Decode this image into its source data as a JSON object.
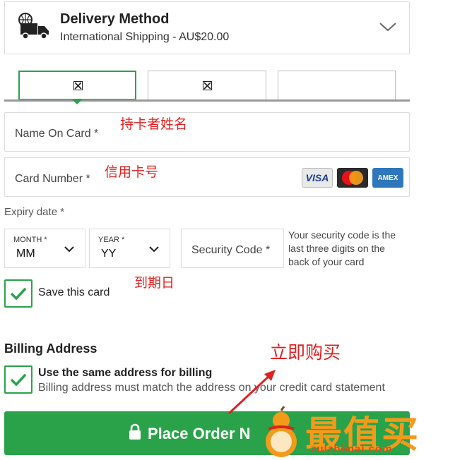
{
  "delivery": {
    "title": "Delivery Method",
    "subtitle": "International Shipping - AU$20.00",
    "icon": "truck-icon"
  },
  "payment_tabs": {
    "active_color": "#2aa24a"
  },
  "fields": {
    "name_on_card": "Name On Card *",
    "card_number": "Card Number *",
    "card_brands": [
      "VISA",
      "MasterCard",
      "AMEX"
    ],
    "expiry_label": "Expiry date *",
    "month_caption": "MONTH *",
    "month_value": "MM",
    "year_caption": "YEAR *",
    "year_value": "YY",
    "security_code": "Security Code *",
    "security_hint": "Your security code is the last three digits on the back of your card"
  },
  "save_card": {
    "label": "Save this card",
    "checked": true
  },
  "billing": {
    "title": "Billing Address",
    "same_label": "Use the same address for billing",
    "same_sub": "Billing address must match the address on your credit card statement",
    "checked": true
  },
  "place_order": {
    "label": "Place Order N"
  },
  "annotations": {
    "name": "持卡者姓名",
    "card": "信用卡号",
    "expiry": "到期日",
    "buy": "立即购买"
  },
  "watermark": {
    "text": "最值买",
    "url": "zuizhimai.com"
  },
  "colors": {
    "accent": "#2aa24a",
    "annotation": "#e02020"
  }
}
